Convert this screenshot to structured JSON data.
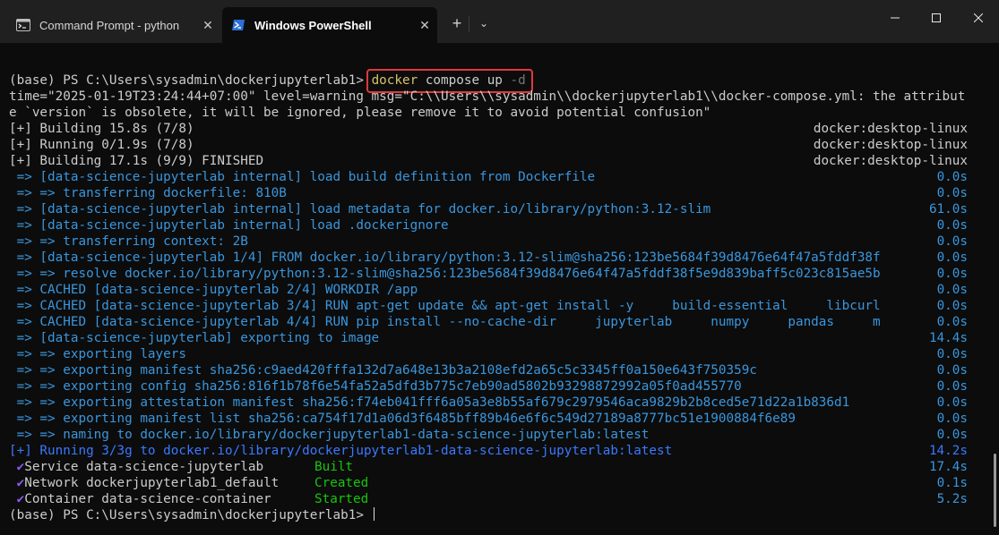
{
  "tabs": [
    {
      "title": "Command Prompt - python",
      "close": "✕",
      "icon": "cmd-icon"
    },
    {
      "title": "Windows PowerShell",
      "close": "✕",
      "icon": "powershell-icon"
    }
  ],
  "new_tab": "+",
  "dropdown": "⌄",
  "colors": {
    "accent_red": "#e0383c",
    "cyan": "#3a96dd",
    "blue": "#3b78ff",
    "yellow": "#d7c26a",
    "check": "#8a5cf0",
    "built": "#16c60c"
  },
  "terminal": {
    "prompt": "(base) PS C:\\Users\\sysadmin\\dockerjupyterlab1>",
    "command": {
      "exe": "docker",
      "args": "compose up",
      "flag": "-d"
    },
    "warning": "time=\"2025-01-19T23:24:44+07:00\" level=warning msg=\"C:\\\\Users\\\\sysadmin\\\\dockerjupyterlab1\\\\docker-compose.yml: the attribute `version` is obsolete, it will be ignored, please remove it to avoid potential confusion\"",
    "status": [
      {
        "left": "[+] Building 15.8s (7/8)",
        "right": "docker:desktop-linux"
      },
      {
        "left": "[+] Running 0/1.9s (7/8)",
        "right": "docker:desktop-linux"
      },
      {
        "left": "[+] Building 17.1s (9/9) FINISHED",
        "right": "docker:desktop-linux"
      }
    ],
    "steps": [
      {
        "text": " => [data-science-jupyterlab internal] load build definition from Dockerfile",
        "time": "0.0s"
      },
      {
        "text": " => => transferring dockerfile: 810B",
        "time": "0.0s"
      },
      {
        "text": " => [data-science-jupyterlab internal] load metadata for docker.io/library/python:3.12-slim",
        "time": "61.0s"
      },
      {
        "text": " => [data-science-jupyterlab internal] load .dockerignore",
        "time": "0.0s"
      },
      {
        "text": " => => transferring context: 2B",
        "time": "0.0s"
      },
      {
        "text": " => [data-science-jupyterlab 1/4] FROM docker.io/library/python:3.12-slim@sha256:123be5684f39d8476e64f47a5fddf38f",
        "time": "0.0s"
      },
      {
        "text": " => => resolve docker.io/library/python:3.12-slim@sha256:123be5684f39d8476e64f47a5fddf38f5e9d839baff5c023c815ae5b",
        "time": "0.0s"
      },
      {
        "text": " => CACHED [data-science-jupyterlab 2/4] WORKDIR /app",
        "time": "0.0s"
      },
      {
        "text": " => CACHED [data-science-jupyterlab 3/4] RUN apt-get update && apt-get install -y     build-essential     libcurl",
        "time": "0.0s"
      },
      {
        "text": " => CACHED [data-science-jupyterlab 4/4] RUN pip install --no-cache-dir     jupyterlab     numpy     pandas     m",
        "time": "0.0s"
      },
      {
        "text": " => [data-science-jupyterlab] exporting to image",
        "time": "14.4s"
      },
      {
        "text": " => => exporting layers",
        "time": "0.0s"
      },
      {
        "text": " => => exporting manifest sha256:c9aed420fffa132d7a648e13b3a2108efd2a65c5c3345ff0a150e643f750359c",
        "time": "0.0s"
      },
      {
        "text": " => => exporting config sha256:816f1b78f6e54fa52a5dfd3b775c7eb90ad5802b93298872992a05f0ad455770",
        "time": "0.0s"
      },
      {
        "text": " => => exporting attestation manifest sha256:f74eb041fff6a05a3e8b55af679c2979546aca9829b2b8ced5e71d22a1b836d1",
        "time": "0.0s"
      },
      {
        "text": " => => exporting manifest list sha256:ca754f17d1a06d3f6485bff89b46e6f6c549d27189a8777bc51e1900884f6e89",
        "time": "0.0s"
      },
      {
        "text": " => => naming to docker.io/library/dockerjupyterlab1-data-science-jupyterlab:latest",
        "time": "0.0s"
      }
    ],
    "running": {
      "text": "[+] Running 3/3g to docker.io/library/dockerjupyterlab1-data-science-jupyterlab:latest",
      "time": "14.2s"
    },
    "services": [
      {
        "check": "✔",
        "kind": "Service",
        "name": "data-science-jupyterlab",
        "state": "Built",
        "time": "17.4s"
      },
      {
        "check": "✔",
        "kind": "Network",
        "name": "dockerjupyterlab1_default",
        "state": "Created",
        "time": "0.1s"
      },
      {
        "check": "✔",
        "kind": "Container",
        "name": "data-science-container",
        "state": "Started",
        "time": "5.2s"
      }
    ],
    "final_prompt": "(base) PS C:\\Users\\sysadmin\\dockerjupyterlab1>"
  }
}
